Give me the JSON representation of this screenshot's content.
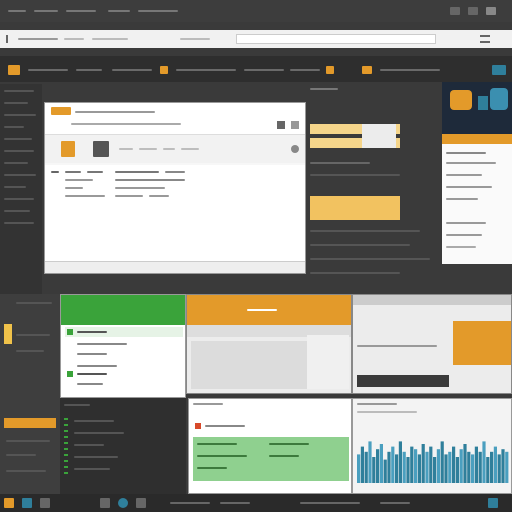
{
  "colors": {
    "accent_orange": "#e39a2a",
    "accent_green": "#3aa33a",
    "chart_teal": "#2f7f9b",
    "dark_bg": "#3a3a3a",
    "panel_dark": "#2b2b2b",
    "light_bg": "#ececec"
  },
  "icons": {
    "app_icons": [
      "folder-icon",
      "doc-icon",
      "gear-icon",
      "search-icon",
      "play-icon",
      "grid-icon",
      "window-icon",
      "close-icon"
    ]
  },
  "taskbar": {
    "icon_count": 8
  },
  "chart": {
    "bars": [
      0.55,
      0.7,
      0.6,
      0.8,
      0.5,
      0.65,
      0.75,
      0.45,
      0.6,
      0.7,
      0.55,
      0.8,
      0.6,
      0.5,
      0.7,
      0.65,
      0.55,
      0.75,
      0.6,
      0.7,
      0.5,
      0.65,
      0.8,
      0.55,
      0.6,
      0.7,
      0.5,
      0.65,
      0.75,
      0.6,
      0.55,
      0.7,
      0.6,
      0.8,
      0.5,
      0.6,
      0.7,
      0.55,
      0.65,
      0.6
    ]
  }
}
